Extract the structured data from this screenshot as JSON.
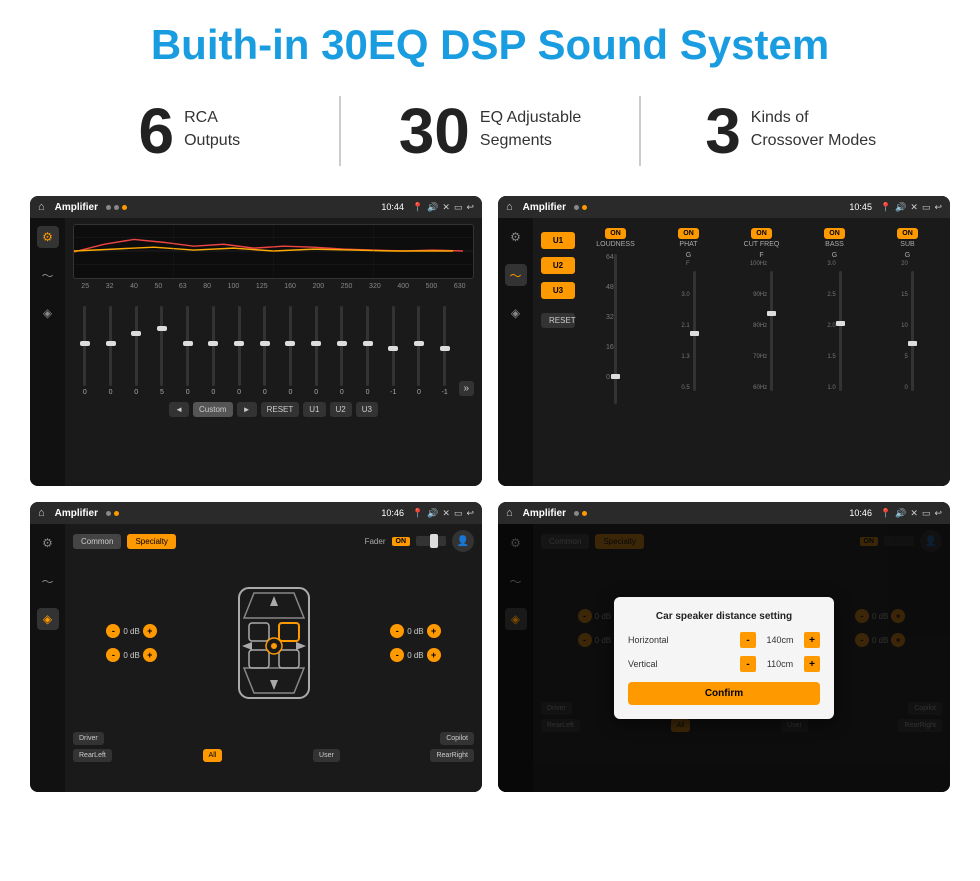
{
  "header": {
    "title": "Buith-in 30EQ DSP Sound System"
  },
  "stats": [
    {
      "number": "6",
      "label": "RCA\nOutputs"
    },
    {
      "number": "30",
      "label": "EQ Adjustable\nSegments"
    },
    {
      "number": "3",
      "label": "Kinds of\nCrossover Modes"
    }
  ],
  "screens": [
    {
      "id": "eq-screen",
      "app": "Amplifier",
      "time": "10:44",
      "type": "eq"
    },
    {
      "id": "crossover-screen",
      "app": "Amplifier",
      "time": "10:45",
      "type": "crossover"
    },
    {
      "id": "fader-screen",
      "app": "Amplifier",
      "time": "10:46",
      "type": "fader"
    },
    {
      "id": "distance-screen",
      "app": "Amplifier",
      "time": "10:46",
      "type": "distance",
      "dialog": {
        "title": "Car speaker distance setting",
        "horizontal_label": "Horizontal",
        "horizontal_value": "140cm",
        "vertical_label": "Vertical",
        "vertical_value": "110cm",
        "confirm_label": "Confirm"
      }
    }
  ],
  "eq_labels": [
    "25",
    "32",
    "40",
    "50",
    "63",
    "80",
    "100",
    "125",
    "160",
    "200",
    "250",
    "320",
    "400",
    "500",
    "630"
  ],
  "eq_values": [
    "0",
    "0",
    "0",
    "5",
    "0",
    "0",
    "0",
    "0",
    "0",
    "0",
    "0",
    "0",
    "-1",
    "0",
    "-1"
  ],
  "eq_controls": [
    "◄",
    "Custom",
    "►",
    "RESET",
    "U1",
    "U2",
    "U3"
  ],
  "crossover_presets": [
    "U1",
    "U2",
    "U3"
  ],
  "crossover_cols": [
    "LOUDNESS",
    "PHAT",
    "CUT FREQ",
    "BASS",
    "SUB"
  ],
  "crossover_toggles": [
    "ON",
    "ON",
    "ON",
    "ON",
    "ON"
  ],
  "fader_tabs": [
    "Common",
    "Specialty"
  ],
  "fader_label": "Fader",
  "bottom_buttons_fader": [
    "Driver",
    "",
    "Copilot",
    "RearLeft",
    "All",
    "User",
    "RearRight"
  ],
  "bottom_buttons_distance": [
    "Driver",
    "",
    "Copilot",
    "RearLeft",
    "All",
    "User",
    "RearRight"
  ]
}
